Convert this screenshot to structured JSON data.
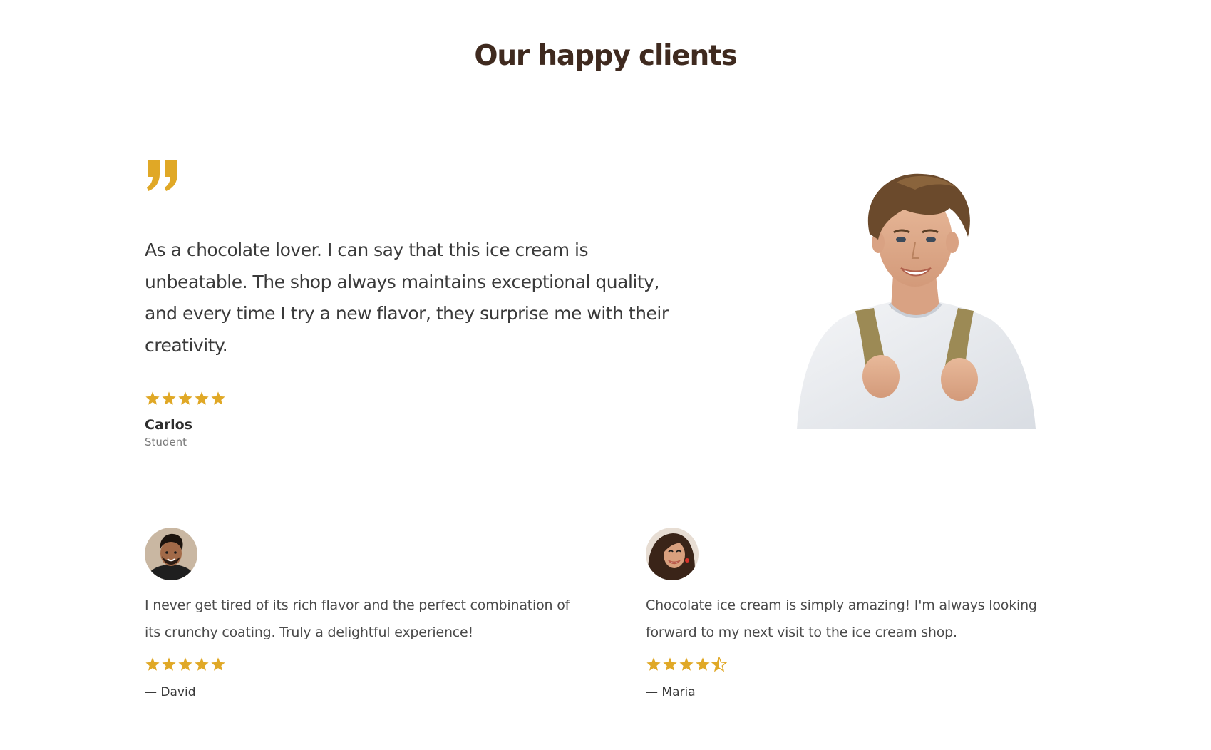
{
  "section": {
    "title": "Our happy clients"
  },
  "featured": {
    "quote": "As a chocolate lover. I can say that this ice cream is unbeatable. The shop always maintains exceptional quality, and every time I try a new flavor, they surprise me with their creativity.",
    "rating": 5,
    "name": "Carlos",
    "role": "Student"
  },
  "reviews": [
    {
      "text": "I never get tired of its rich flavor and the perfect combination of its crunchy coating. Truly a delightful experience!",
      "rating": 5,
      "author": "— David"
    },
    {
      "text": "Chocolate ice cream is simply amazing! I'm always looking forward to my next visit to the ice cream shop.",
      "rating": 4.5,
      "author": "— Maria"
    }
  ],
  "colors": {
    "accent": "#e0a826",
    "heading": "#3f2a1f",
    "text": "#3a3a3a",
    "muted": "#7a7a7a"
  }
}
